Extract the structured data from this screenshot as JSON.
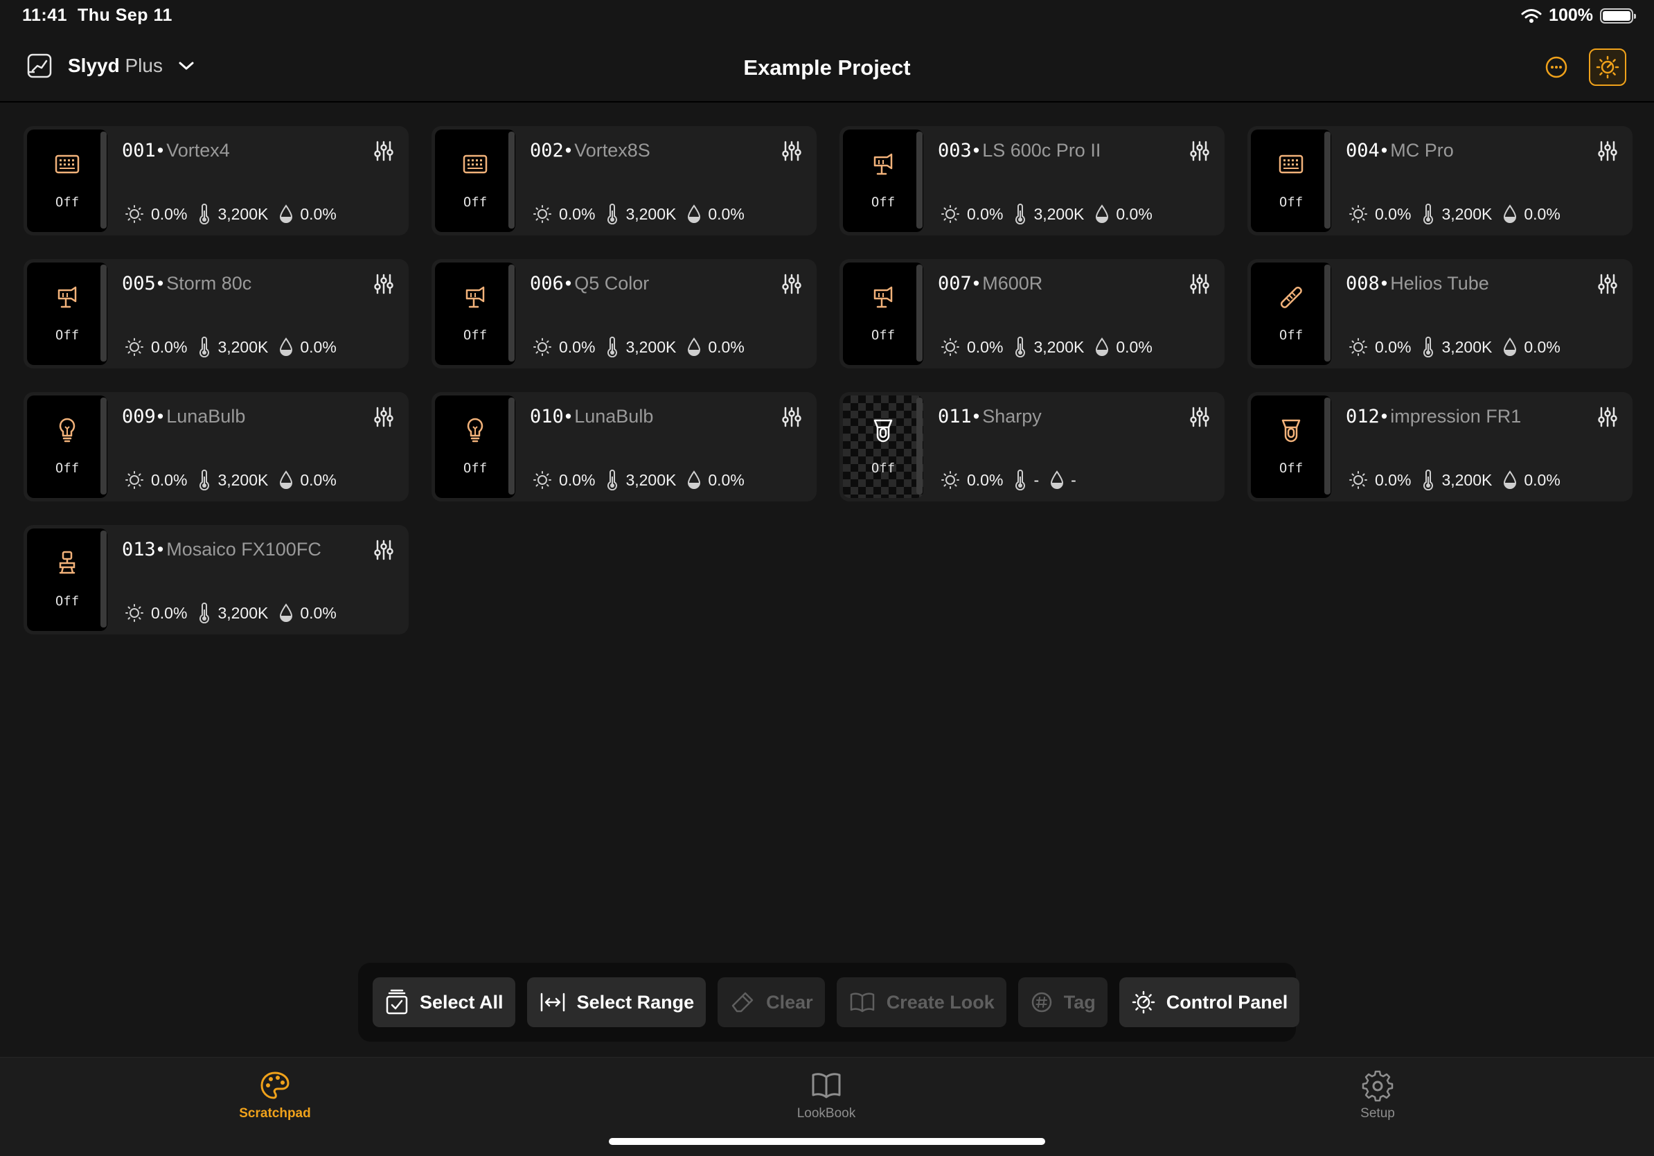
{
  "status": {
    "time": "11:41",
    "date": "Thu Sep 11",
    "battery": "100%"
  },
  "nav": {
    "app_name": "Slyyd",
    "app_tier": "Plus",
    "title": "Example Project"
  },
  "fixtures": [
    {
      "num": "001",
      "model": "Vortex4",
      "state": "Off",
      "intensity": "0.0%",
      "cct": "3,200K",
      "saturation": "0.0%",
      "icon": "panel-icon",
      "checker": false
    },
    {
      "num": "002",
      "model": "Vortex8S",
      "state": "Off",
      "intensity": "0.0%",
      "cct": "3,200K",
      "saturation": "0.0%",
      "icon": "panel-icon",
      "checker": false
    },
    {
      "num": "003",
      "model": "LS 600c Pro II",
      "state": "Off",
      "intensity": "0.0%",
      "cct": "3,200K",
      "saturation": "0.0%",
      "icon": "spotlight-icon",
      "checker": false
    },
    {
      "num": "004",
      "model": "MC Pro",
      "state": "Off",
      "intensity": "0.0%",
      "cct": "3,200K",
      "saturation": "0.0%",
      "icon": "panel-icon",
      "checker": false
    },
    {
      "num": "005",
      "model": "Storm 80c",
      "state": "Off",
      "intensity": "0.0%",
      "cct": "3,200K",
      "saturation": "0.0%",
      "icon": "spotlight-icon",
      "checker": false
    },
    {
      "num": "006",
      "model": "Q5 Color",
      "state": "Off",
      "intensity": "0.0%",
      "cct": "3,200K",
      "saturation": "0.0%",
      "icon": "spotlight-icon",
      "checker": false
    },
    {
      "num": "007",
      "model": "M600R",
      "state": "Off",
      "intensity": "0.0%",
      "cct": "3,200K",
      "saturation": "0.0%",
      "icon": "spotlight-icon",
      "checker": false
    },
    {
      "num": "008",
      "model": "Helios Tube",
      "state": "Off",
      "intensity": "0.0%",
      "cct": "3,200K",
      "saturation": "0.0%",
      "icon": "tube-icon",
      "checker": false
    },
    {
      "num": "009",
      "model": "LunaBulb",
      "state": "Off",
      "intensity": "0.0%",
      "cct": "3,200K",
      "saturation": "0.0%",
      "icon": "bulb-icon",
      "checker": false
    },
    {
      "num": "010",
      "model": "LunaBulb",
      "state": "Off",
      "intensity": "0.0%",
      "cct": "3,200K",
      "saturation": "0.0%",
      "icon": "bulb-icon",
      "checker": false
    },
    {
      "num": "011",
      "model": "Sharpy",
      "state": "Off",
      "intensity": "0.0%",
      "cct": "-",
      "saturation": "-",
      "icon": "moving-head-icon",
      "checker": true
    },
    {
      "num": "012",
      "model": "impression FR1",
      "state": "Off",
      "intensity": "0.0%",
      "cct": "3,200K",
      "saturation": "0.0%",
      "icon": "moving-head-icon",
      "checker": false
    },
    {
      "num": "013",
      "model": "Mosaico FX100FC",
      "state": "Off",
      "intensity": "0.0%",
      "cct": "3,200K",
      "saturation": "0.0%",
      "icon": "lantern-icon",
      "checker": false
    }
  ],
  "toolbar": {
    "select_all": "Select All",
    "select_range": "Select Range",
    "clear": "Clear",
    "create_look": "Create Look",
    "tag": "Tag",
    "control_panel": "Control Panel"
  },
  "tabs": {
    "scratchpad": "Scratchpad",
    "lookbook": "LookBook",
    "setup": "Setup"
  },
  "colors": {
    "accent": "#f0a21b",
    "fixture_icon": "#f2b27a",
    "background": "#161616",
    "card": "#1f1f1f"
  }
}
